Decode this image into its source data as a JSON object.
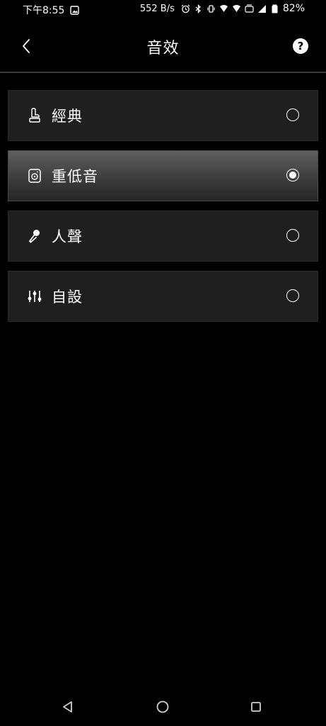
{
  "status_bar": {
    "time": "下午8:55",
    "network_speed": "552 B/s",
    "battery": "82%"
  },
  "header": {
    "title": "音效",
    "help_label": "?"
  },
  "options": [
    {
      "label": "經典",
      "icon": "gramophone-icon",
      "selected": false
    },
    {
      "label": "重低音",
      "icon": "speaker-icon",
      "selected": true
    },
    {
      "label": "人聲",
      "icon": "microphone-icon",
      "selected": false
    },
    {
      "label": "自設",
      "icon": "equalizer-icon",
      "selected": false
    }
  ],
  "colors": {
    "background": "#000000",
    "option_bg": "#1f1f1f",
    "selected_gradient_top": "#5f5f5f",
    "text": "#ffffff"
  }
}
